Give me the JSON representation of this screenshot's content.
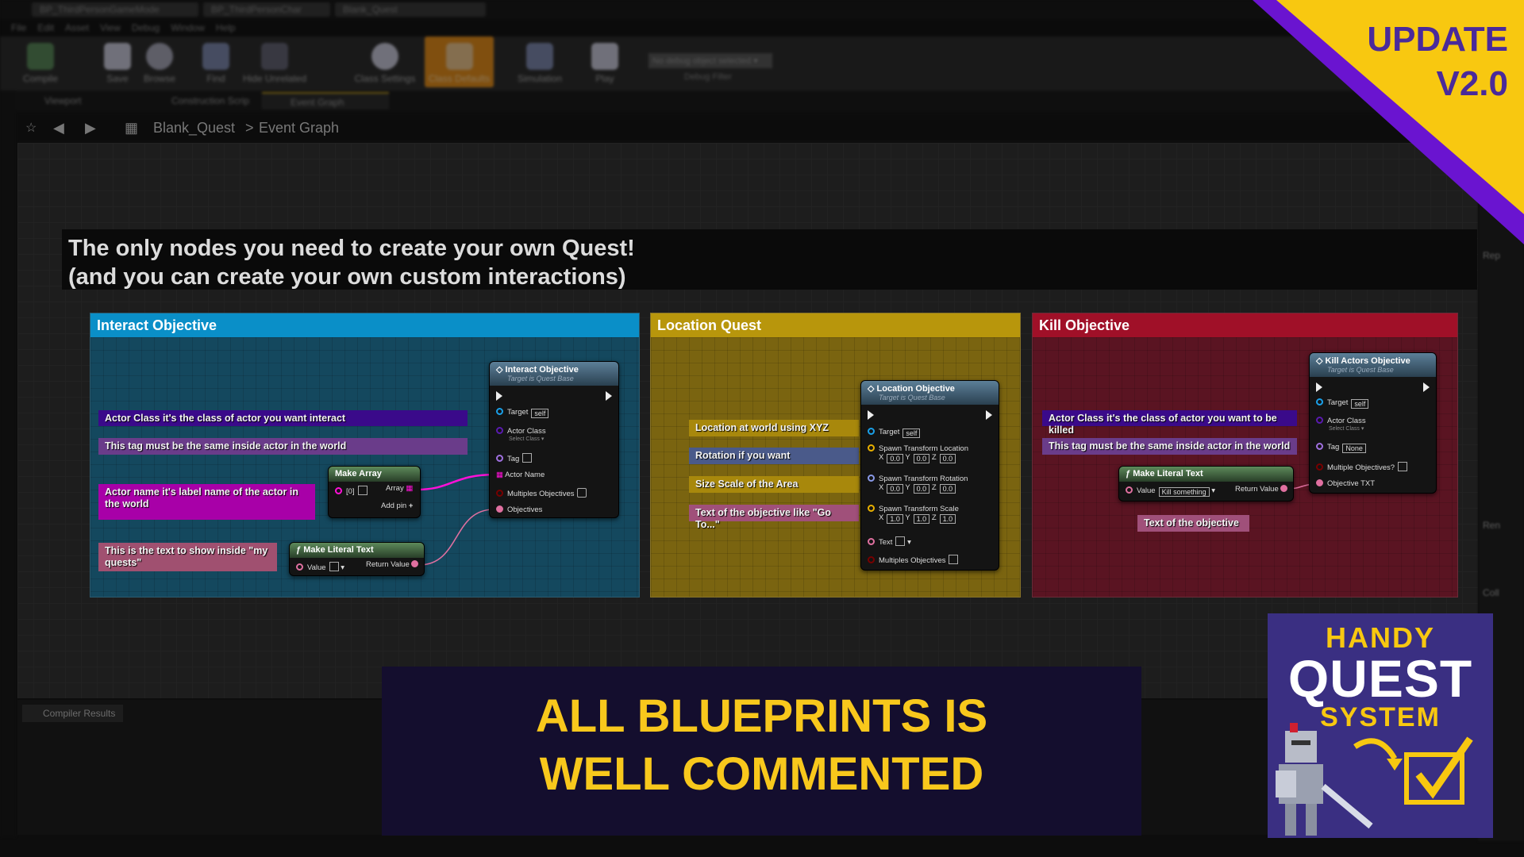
{
  "window": {
    "tabs": [
      "BP_ThirdPersonGameMode",
      "BP_ThirdPersonChar",
      "Blank_Quest"
    ]
  },
  "menu": [
    "File",
    "Edit",
    "Asset",
    "View",
    "Debug",
    "Window",
    "Help"
  ],
  "toolbar": {
    "buttons": [
      "Compile",
      "Save",
      "Browse",
      "Find",
      "Hide Unrelated",
      "Class Settings",
      "Class Defaults",
      "Simulation",
      "Play"
    ],
    "active": "Class Defaults",
    "debug_select": "No debug object selected",
    "debug_label": "Debug Filter"
  },
  "editor_tabs": [
    "Viewport",
    "Construction Scrip",
    "Event Graph"
  ],
  "breadcrumb": {
    "root": "Blank_Quest",
    "sep": ">",
    "current": "Event Graph"
  },
  "header_comment": {
    "line1": "The only nodes you need to create your own Quest!",
    "line2": "(and you can create your own custom interactions)"
  },
  "panels": {
    "interact": {
      "title": "Interact Objective",
      "color": "#0a8fc8",
      "comments": [
        "Actor Class it's the class of actor you want interact",
        "This tag must be the same inside actor in the world",
        "Actor name it's label name of the actor in the world",
        "This is the text to show inside \"my quests\""
      ],
      "node": {
        "title": "Interact Objective",
        "subtitle": "Target is Quest Base",
        "target": "Target",
        "self": "self",
        "actor_class": "Actor Class",
        "select_class": "Select Class",
        "tag": "Tag",
        "actor_name": "Actor Name",
        "multiples": "Multiples Objectives",
        "objectives": "Objectives"
      },
      "make_array": {
        "title": "Make Array",
        "index": "[0]",
        "array": "Array",
        "add_pin": "Add pin"
      },
      "literal": {
        "title": "Make Literal Text",
        "value": "Value",
        "return": "Return Value"
      }
    },
    "location": {
      "title": "Location Quest",
      "color": "#b8960c",
      "comments": [
        "Location at world using XYZ",
        "Rotation if you want",
        "Size Scale of the Area",
        "Text of the objective like \"Go To...\""
      ],
      "node": {
        "title": "Location Objective",
        "subtitle": "Target is Quest Base",
        "target": "Target",
        "self": "self",
        "loc": "Spawn Transform Location",
        "rot": "Spawn Transform Rotation",
        "scale": "Spawn Transform Scale",
        "loc_vals": [
          "0.0",
          "0.0",
          "0.0"
        ],
        "rot_vals": [
          "0.0",
          "0.0",
          "0.0"
        ],
        "scale_vals": [
          "1.0",
          "1.0",
          "1.0"
        ],
        "text": "Text",
        "multiples": "Multiples Objectives"
      }
    },
    "kill": {
      "title": "Kill Objective",
      "color": "#a01028",
      "comments": [
        "Actor Class it's the class of actor you want to be killed",
        "This tag must be the same inside actor in the world",
        "Text of the objective"
      ],
      "node": {
        "title": "Kill Actors Objective",
        "subtitle": "Target is Quest Base",
        "target": "Target",
        "self": "self",
        "actor_class": "Actor Class",
        "select_class": "Select Class",
        "tag": "Tag",
        "tag_val": "None",
        "multiple": "Multiple Objectives?",
        "objective_txt": "Objective TXT"
      },
      "literal": {
        "title": "Make Literal Text",
        "value": "Value",
        "value_text": "Kill something",
        "return": "Return Value"
      }
    }
  },
  "side_panel": [
    "Rep",
    "Ren",
    "Coll"
  ],
  "bottom_tab": "Compiler Results",
  "update_badge": {
    "line1": "UPDATE",
    "line2": "V2.0"
  },
  "banner": {
    "line1": "ALL BLUEPRINTS IS",
    "line2": "WELL COMMENTED"
  },
  "logo": {
    "line1": "HANDY",
    "line2": "QUEST",
    "line3": "SYSTEM"
  }
}
